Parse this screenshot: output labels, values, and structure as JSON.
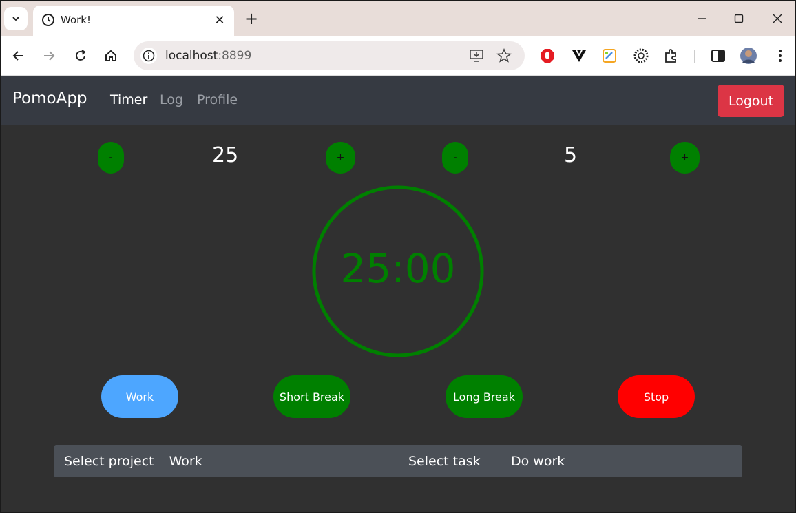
{
  "browser": {
    "tab_title": "Work!",
    "url_host": "localhost",
    "url_port": ":8899"
  },
  "app": {
    "brand": "PomoApp",
    "nav": [
      "Timer",
      "Log",
      "Profile"
    ],
    "logout_label": "Logout"
  },
  "timer": {
    "work_minutes": "25",
    "break_minutes": "5",
    "decrement_label": "-",
    "increment_label": "+",
    "display": "25:00",
    "accent_color": "#008000"
  },
  "modes": [
    "Work",
    "Short Break",
    "Long Break",
    "Stop"
  ],
  "selectors": {
    "project_label": "Select project",
    "project_value": "Work",
    "task_label": "Select task",
    "task_value": "Do work"
  },
  "colors": {
    "work": "#4da6ff",
    "break": "#008000",
    "stop": "#ff0000",
    "logout": "#dc3545"
  }
}
